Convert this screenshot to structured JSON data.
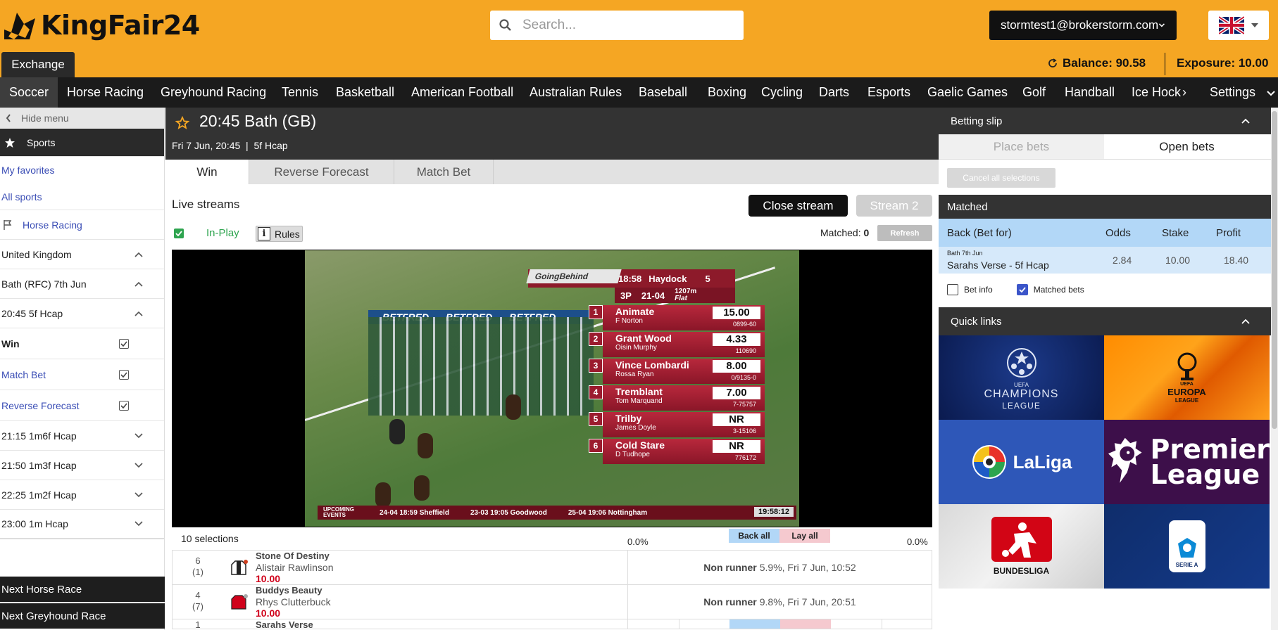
{
  "app": {
    "name": "KingFair24"
  },
  "header": {
    "search_placeholder": "Search...",
    "user_email": "stormtest1@brokerstorm.com",
    "exchange_label": "Exchange",
    "balance": "Balance: 90.58",
    "exposure": "Exposure: 10.00"
  },
  "sports_nav": {
    "items": [
      "Soccer",
      "Horse Racing",
      "Greyhound Racing",
      "Tennis",
      "Basketball",
      "American Football",
      "Australian Rules",
      "Baseball",
      "Boxing",
      "Cycling",
      "Darts",
      "Esports",
      "Gaelic Games",
      "Golf",
      "Handball",
      "Ice Hock"
    ],
    "settings": "Settings"
  },
  "sidebar": {
    "hide_menu": "Hide menu",
    "sports": "Sports",
    "my_favorites": "My favorites",
    "all_sports": "All sports",
    "horse_racing": "Horse Racing",
    "country": "United Kingdom",
    "meeting": "Bath (RFC) 7th Jun",
    "race": "20:45 5f Hcap",
    "markets": [
      "Win",
      "Match Bet",
      "Reverse Forecast"
    ],
    "other_races": [
      "21:15 1m6f Hcap",
      "21:50 1m3f Hcap",
      "22:25 1m2f Hcap",
      "23:00 1m Hcap"
    ],
    "next_horse": "Next Horse Race",
    "next_greyhound": "Next Greyhound Race"
  },
  "event": {
    "title": "20:45 Bath (GB)",
    "subtitle": "Fri 7 Jun, 20:45  |  5f Hcap",
    "tabs": [
      "Win",
      "Reverse Forecast",
      "Match Bet"
    ],
    "live_streams": "Live streams",
    "close_stream": "Close stream",
    "stream2": "Stream 2",
    "in_play": "In-Play",
    "rules": "Rules",
    "matched_label": "Matched:",
    "matched_value": "0",
    "refresh": "Refresh",
    "selections": "10 selections",
    "back_pct": "0.0%",
    "lay_pct": "0.0%",
    "back_all": "Back all",
    "lay_all": "Lay all"
  },
  "video_overlay": {
    "going": "GoingBehind",
    "time": "18:58",
    "course": "Haydock",
    "count": "5",
    "class": "3P",
    "date": "21-04",
    "distance": "1207m",
    "surface": "Flat",
    "banner": "BETFRED",
    "runners": [
      {
        "num": "1",
        "name": "Animate",
        "jockey": "F Norton",
        "price": "15.00",
        "id": "0899-60"
      },
      {
        "num": "2",
        "name": "Grant Wood",
        "jockey": "Oisin Murphy",
        "price": "4.33",
        "id": "110690"
      },
      {
        "num": "3",
        "name": "Vince Lombardi",
        "jockey": "Rossa Ryan",
        "price": "8.00",
        "id": "0/9135-0"
      },
      {
        "num": "4",
        "name": "Tremblant",
        "jockey": "Tom Marquand",
        "price": "7.00",
        "id": "7-75757"
      },
      {
        "num": "5",
        "name": "Trilby",
        "jockey": "James Doyle",
        "price": "NR",
        "id": "3-15106"
      },
      {
        "num": "6",
        "name": "Cold Stare",
        "jockey": "D Tudhope",
        "price": "NR",
        "id": "776172"
      }
    ],
    "ticker_label": "UPCOMING EVENTS",
    "ticker_items": [
      "24-04 18:59 Sheffield",
      "23-03 19:05 Goodwood",
      "25-04 19:06 Nottingham"
    ],
    "clock": "19:58:12"
  },
  "runners": [
    {
      "num": "6",
      "draw": "(1)",
      "name": "Stone Of Destiny",
      "jockey": "Alistair Rawlinson",
      "odds": "10.00",
      "status": "Non runner",
      "detail": "5.9%, Fri 7 Jun, 10:52"
    },
    {
      "num": "4",
      "draw": "(7)",
      "name": "Buddys Beauty",
      "jockey": "Rhys Clutterbuck",
      "odds": "10.00",
      "status": "Non runner",
      "detail": "9.8%, Fri 7 Jun, 20:51"
    },
    {
      "num": "1",
      "name": "Sarahs Verse"
    }
  ],
  "betslip": {
    "title": "Betting slip",
    "tab_place": "Place bets",
    "tab_open": "Open bets",
    "cancel_all": "Cancel all selections",
    "matched": "Matched",
    "col_back": "Back (Bet for)",
    "col_odds": "Odds",
    "col_stake": "Stake",
    "col_profit": "Profit",
    "bet_meta": "Bath 7th Jun",
    "bet_sel": "Sarahs Verse - 5f Hcap",
    "bet_odds": "2.84",
    "bet_stake": "10.00",
    "bet_profit": "18.40",
    "bet_info": "Bet info",
    "matched_bets": "Matched bets",
    "quick_links": "Quick links",
    "leagues": {
      "ucl_1": "CHAMPIONS",
      "ucl_2": "LEAGUE",
      "uel_1": "EUROPA",
      "uel_2": "LEAGUE",
      "uefa": "UEFA",
      "laliga": "LaLiga",
      "pl_1": "Premier",
      "pl_2": "League",
      "bundesliga": "BUNDESLIGA",
      "seriea": "SERIE A"
    }
  },
  "colors": {
    "brand": "#f5a623",
    "dark": "#333333",
    "back": "#b2d7f7",
    "lay": "#f5c9cf"
  }
}
